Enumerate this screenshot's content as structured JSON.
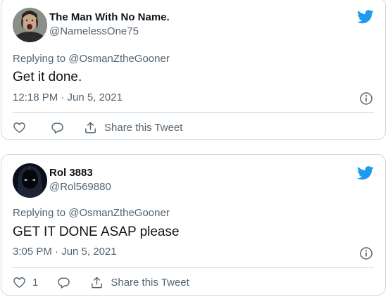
{
  "colors": {
    "twitter_blue": "#1d9bf0",
    "text_primary": "#0f1419",
    "text_secondary": "#536471",
    "border": "#cfd9de"
  },
  "tweets": [
    {
      "display_name": "The Man With No Name.",
      "handle": "@NamelessOne75",
      "replying_to": "Replying to @OsmanZtheGooner",
      "text": "Get it done.",
      "timestamp": "12:18 PM · Jun 5, 2021",
      "like_count": "",
      "share_label": "Share this Tweet",
      "avatar_icon": "man-avatar",
      "logo_icon": "twitter-bird-icon"
    },
    {
      "display_name": "Rol 3883",
      "handle": "@Rol569880",
      "replying_to": "Replying to @OsmanZtheGooner",
      "text": "GET IT DONE ASAP please",
      "timestamp": "3:05 PM · Jun 5, 2021",
      "like_count": "1",
      "share_label": "Share this Tweet",
      "avatar_icon": "hooded-figure-avatar",
      "logo_icon": "twitter-bird-icon"
    }
  ]
}
